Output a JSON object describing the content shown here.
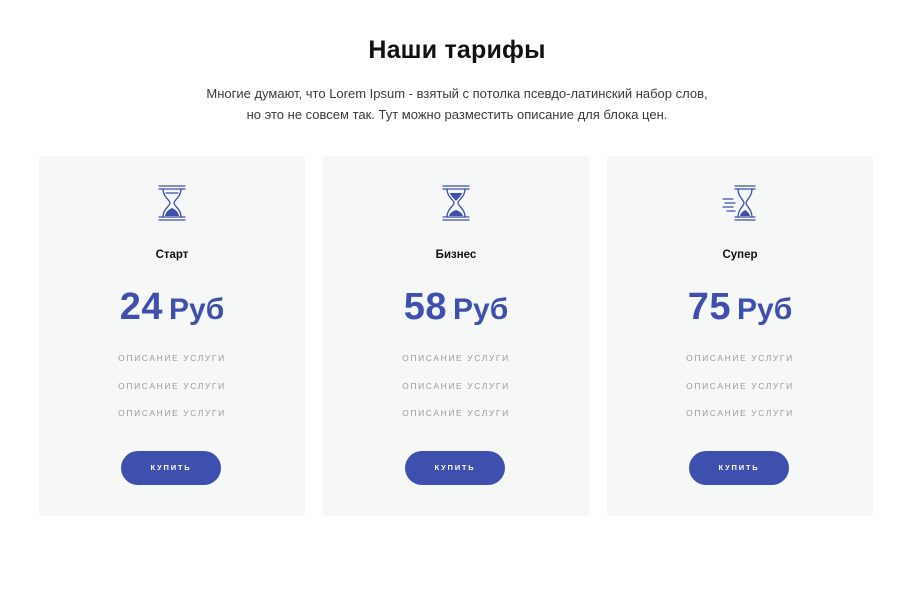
{
  "heading": "Наши тарифы",
  "description": {
    "line1": "Многие думают, что Lorem Ipsum - взятый с потолка псевдо-латинский набор слов,",
    "line2": "но это не совсем так. Тут можно разместить описание для блока цен."
  },
  "colors": {
    "accent": "#3f4fae",
    "card_background": "#f6f8f8",
    "feature_text": "#9a9a9a"
  },
  "plans": [
    {
      "icon": "hourglass-icon",
      "name": "Старт",
      "amount": "24",
      "currency": "Руб",
      "features": [
        "ОПИСАНИЕ УСЛУГИ",
        "ОПИСАНИЕ УСЛУГИ",
        "ОПИСАНИЕ УСЛУГИ"
      ],
      "button_label": "КУПИТЬ"
    },
    {
      "icon": "hourglass-icon",
      "name": "Бизнес",
      "amount": "58",
      "currency": "Руб",
      "features": [
        "ОПИСАНИЕ УСЛУГИ",
        "ОПИСАНИЕ УСЛУГИ",
        "ОПИСАНИЕ УСЛУГИ"
      ],
      "button_label": "КУПИТЬ"
    },
    {
      "icon": "fast-hourglass-icon",
      "name": "Супер",
      "amount": "75",
      "currency": "Руб",
      "features": [
        "ОПИСАНИЕ УСЛУГИ",
        "ОПИСАНИЕ УСЛУГИ",
        "ОПИСАНИЕ УСЛУГИ"
      ],
      "button_label": "КУПИТЬ"
    }
  ]
}
